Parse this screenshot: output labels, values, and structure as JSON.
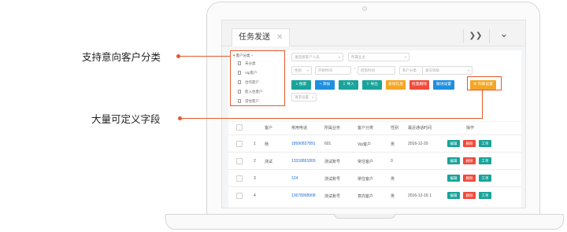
{
  "tabs": [
    {
      "label": "任务发送",
      "close_glyph": "✕"
    }
  ],
  "header_buttons": [
    {
      "glyph": "❯❯"
    },
    {
      "glyph": "⌄"
    }
  ],
  "tree": {
    "root_label": "客户分类",
    "add_glyph": "+",
    "items": [
      "未分类",
      "Vip客户",
      "合作客户",
      "新入住客户",
      "常住客户"
    ]
  },
  "filters": {
    "row1": [
      "请选择客户人员",
      "所属业主"
    ],
    "row2_left": [
      "性别",
      "开始时间"
    ],
    "row2_sep": "~",
    "row2_right": [
      "结束时间",
      "客户分类",
      "意向等级"
    ],
    "row4": [
      "请求设置"
    ]
  },
  "toolbar": [
    {
      "label": "搜索",
      "color": "#1aa39a"
    },
    {
      "label": "添加",
      "color": "#1e8fe0"
    },
    {
      "label": "导入",
      "color": "#1aa39a"
    },
    {
      "label": "导出",
      "color": "#1aa39a"
    },
    {
      "label": "发短信息",
      "color": "#f5a623"
    },
    {
      "label": "批量删除",
      "color": "#ef4b3c"
    },
    {
      "label": "跟进设置",
      "color": "#1e8fe0"
    },
    {
      "label": "列表设置",
      "color": "#f5a623"
    }
  ],
  "table": {
    "headers": [
      "客户",
      "常用电话",
      "所属业务",
      "客户分类",
      "性别",
      "最近通话时间",
      "操作"
    ],
    "rows": [
      {
        "no": "1",
        "name": "杨",
        "phone": "18990837891",
        "biz": "601",
        "category": "Vip客户",
        "gender": "男",
        "time": "2016-12-20"
      },
      {
        "no": "2",
        "name": "测试",
        "phone": "13318891800",
        "biz": "测试账号",
        "category": "常住客户",
        "gender": "0",
        "time": ""
      },
      {
        "no": "3",
        "name": "",
        "phone": "124",
        "biz": "测试账号",
        "category": "常住客户",
        "gender": "男",
        "time": ""
      },
      {
        "no": "4",
        "name": "",
        "phone": "13678998908",
        "biz": "测试账号",
        "category": "意向客户",
        "gender": "男",
        "time": "2016-12-19 1"
      }
    ],
    "actions": [
      {
        "label": "编辑",
        "color": "#1aa39a"
      },
      {
        "label": "删除",
        "color": "#ef4b3c"
      },
      {
        "label": "工单",
        "color": "#1aa39a"
      }
    ]
  },
  "callouts": {
    "tree": "支持意向客户分类",
    "fields": "大量可定义字段",
    "accent_color": "#e35a2c"
  }
}
